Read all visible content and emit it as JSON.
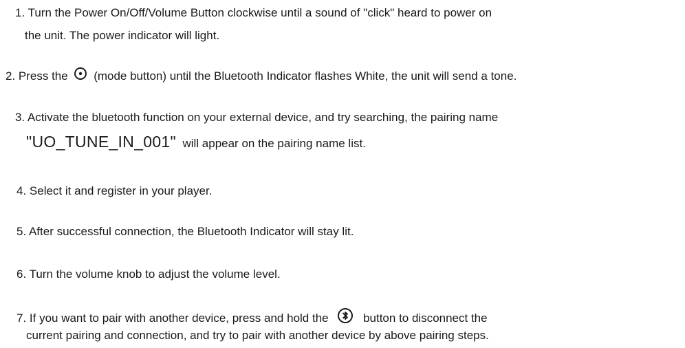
{
  "steps": [
    {
      "line1": "1. Turn the Power On/Off/Volume Button clockwise until a sound of \"click\"  heard to power on",
      "line2": "the unit. The power indicator will light."
    },
    {
      "before": "2. Press the",
      "icon": "mode-button-icon",
      "after": "(mode button) until the Bluetooth Indicator flashes White, the unit will send a tone."
    },
    {
      "line1": "3. Activate the bluetooth function on your external device, and try searching, the pairing name",
      "pairing_name": "\"UO_TUNE_IN_001\"",
      "line2_rest": "will appear on the pairing name list."
    },
    {
      "line1": "4. Select it and register in your player."
    },
    {
      "line1": "5. After successful connection, the Bluetooth Indicator will stay lit."
    },
    {
      "line1": "6. Turn the volume knob to adjust the volume level."
    },
    {
      "before": "7. If you want to pair with another device, press and hold the",
      "icon": "bluetooth-button-icon",
      "after": "button to disconnect the",
      "line2": "current pairing and connection, and try to pair with another device by above pairing steps."
    }
  ]
}
